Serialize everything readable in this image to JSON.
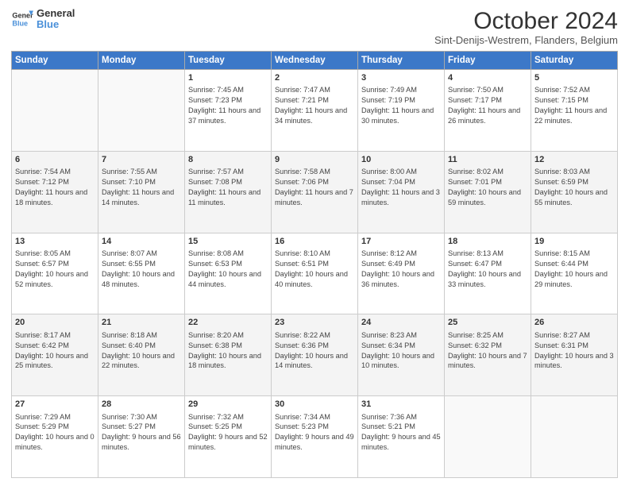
{
  "header": {
    "logo_line1": "General",
    "logo_line2": "Blue",
    "main_title": "October 2024",
    "subtitle": "Sint-Denijs-Westrem, Flanders, Belgium"
  },
  "weekdays": [
    "Sunday",
    "Monday",
    "Tuesday",
    "Wednesday",
    "Thursday",
    "Friday",
    "Saturday"
  ],
  "weeks": [
    [
      {
        "day": "",
        "info": ""
      },
      {
        "day": "",
        "info": ""
      },
      {
        "day": "1",
        "info": "Sunrise: 7:45 AM\nSunset: 7:23 PM\nDaylight: 11 hours and 37 minutes."
      },
      {
        "day": "2",
        "info": "Sunrise: 7:47 AM\nSunset: 7:21 PM\nDaylight: 11 hours and 34 minutes."
      },
      {
        "day": "3",
        "info": "Sunrise: 7:49 AM\nSunset: 7:19 PM\nDaylight: 11 hours and 30 minutes."
      },
      {
        "day": "4",
        "info": "Sunrise: 7:50 AM\nSunset: 7:17 PM\nDaylight: 11 hours and 26 minutes."
      },
      {
        "day": "5",
        "info": "Sunrise: 7:52 AM\nSunset: 7:15 PM\nDaylight: 11 hours and 22 minutes."
      }
    ],
    [
      {
        "day": "6",
        "info": "Sunrise: 7:54 AM\nSunset: 7:12 PM\nDaylight: 11 hours and 18 minutes."
      },
      {
        "day": "7",
        "info": "Sunrise: 7:55 AM\nSunset: 7:10 PM\nDaylight: 11 hours and 14 minutes."
      },
      {
        "day": "8",
        "info": "Sunrise: 7:57 AM\nSunset: 7:08 PM\nDaylight: 11 hours and 11 minutes."
      },
      {
        "day": "9",
        "info": "Sunrise: 7:58 AM\nSunset: 7:06 PM\nDaylight: 11 hours and 7 minutes."
      },
      {
        "day": "10",
        "info": "Sunrise: 8:00 AM\nSunset: 7:04 PM\nDaylight: 11 hours and 3 minutes."
      },
      {
        "day": "11",
        "info": "Sunrise: 8:02 AM\nSunset: 7:01 PM\nDaylight: 10 hours and 59 minutes."
      },
      {
        "day": "12",
        "info": "Sunrise: 8:03 AM\nSunset: 6:59 PM\nDaylight: 10 hours and 55 minutes."
      }
    ],
    [
      {
        "day": "13",
        "info": "Sunrise: 8:05 AM\nSunset: 6:57 PM\nDaylight: 10 hours and 52 minutes."
      },
      {
        "day": "14",
        "info": "Sunrise: 8:07 AM\nSunset: 6:55 PM\nDaylight: 10 hours and 48 minutes."
      },
      {
        "day": "15",
        "info": "Sunrise: 8:08 AM\nSunset: 6:53 PM\nDaylight: 10 hours and 44 minutes."
      },
      {
        "day": "16",
        "info": "Sunrise: 8:10 AM\nSunset: 6:51 PM\nDaylight: 10 hours and 40 minutes."
      },
      {
        "day": "17",
        "info": "Sunrise: 8:12 AM\nSunset: 6:49 PM\nDaylight: 10 hours and 36 minutes."
      },
      {
        "day": "18",
        "info": "Sunrise: 8:13 AM\nSunset: 6:47 PM\nDaylight: 10 hours and 33 minutes."
      },
      {
        "day": "19",
        "info": "Sunrise: 8:15 AM\nSunset: 6:44 PM\nDaylight: 10 hours and 29 minutes."
      }
    ],
    [
      {
        "day": "20",
        "info": "Sunrise: 8:17 AM\nSunset: 6:42 PM\nDaylight: 10 hours and 25 minutes."
      },
      {
        "day": "21",
        "info": "Sunrise: 8:18 AM\nSunset: 6:40 PM\nDaylight: 10 hours and 22 minutes."
      },
      {
        "day": "22",
        "info": "Sunrise: 8:20 AM\nSunset: 6:38 PM\nDaylight: 10 hours and 18 minutes."
      },
      {
        "day": "23",
        "info": "Sunrise: 8:22 AM\nSunset: 6:36 PM\nDaylight: 10 hours and 14 minutes."
      },
      {
        "day": "24",
        "info": "Sunrise: 8:23 AM\nSunset: 6:34 PM\nDaylight: 10 hours and 10 minutes."
      },
      {
        "day": "25",
        "info": "Sunrise: 8:25 AM\nSunset: 6:32 PM\nDaylight: 10 hours and 7 minutes."
      },
      {
        "day": "26",
        "info": "Sunrise: 8:27 AM\nSunset: 6:31 PM\nDaylight: 10 hours and 3 minutes."
      }
    ],
    [
      {
        "day": "27",
        "info": "Sunrise: 7:29 AM\nSunset: 5:29 PM\nDaylight: 10 hours and 0 minutes."
      },
      {
        "day": "28",
        "info": "Sunrise: 7:30 AM\nSunset: 5:27 PM\nDaylight: 9 hours and 56 minutes."
      },
      {
        "day": "29",
        "info": "Sunrise: 7:32 AM\nSunset: 5:25 PM\nDaylight: 9 hours and 52 minutes."
      },
      {
        "day": "30",
        "info": "Sunrise: 7:34 AM\nSunset: 5:23 PM\nDaylight: 9 hours and 49 minutes."
      },
      {
        "day": "31",
        "info": "Sunrise: 7:36 AM\nSunset: 5:21 PM\nDaylight: 9 hours and 45 minutes."
      },
      {
        "day": "",
        "info": ""
      },
      {
        "day": "",
        "info": ""
      }
    ]
  ]
}
